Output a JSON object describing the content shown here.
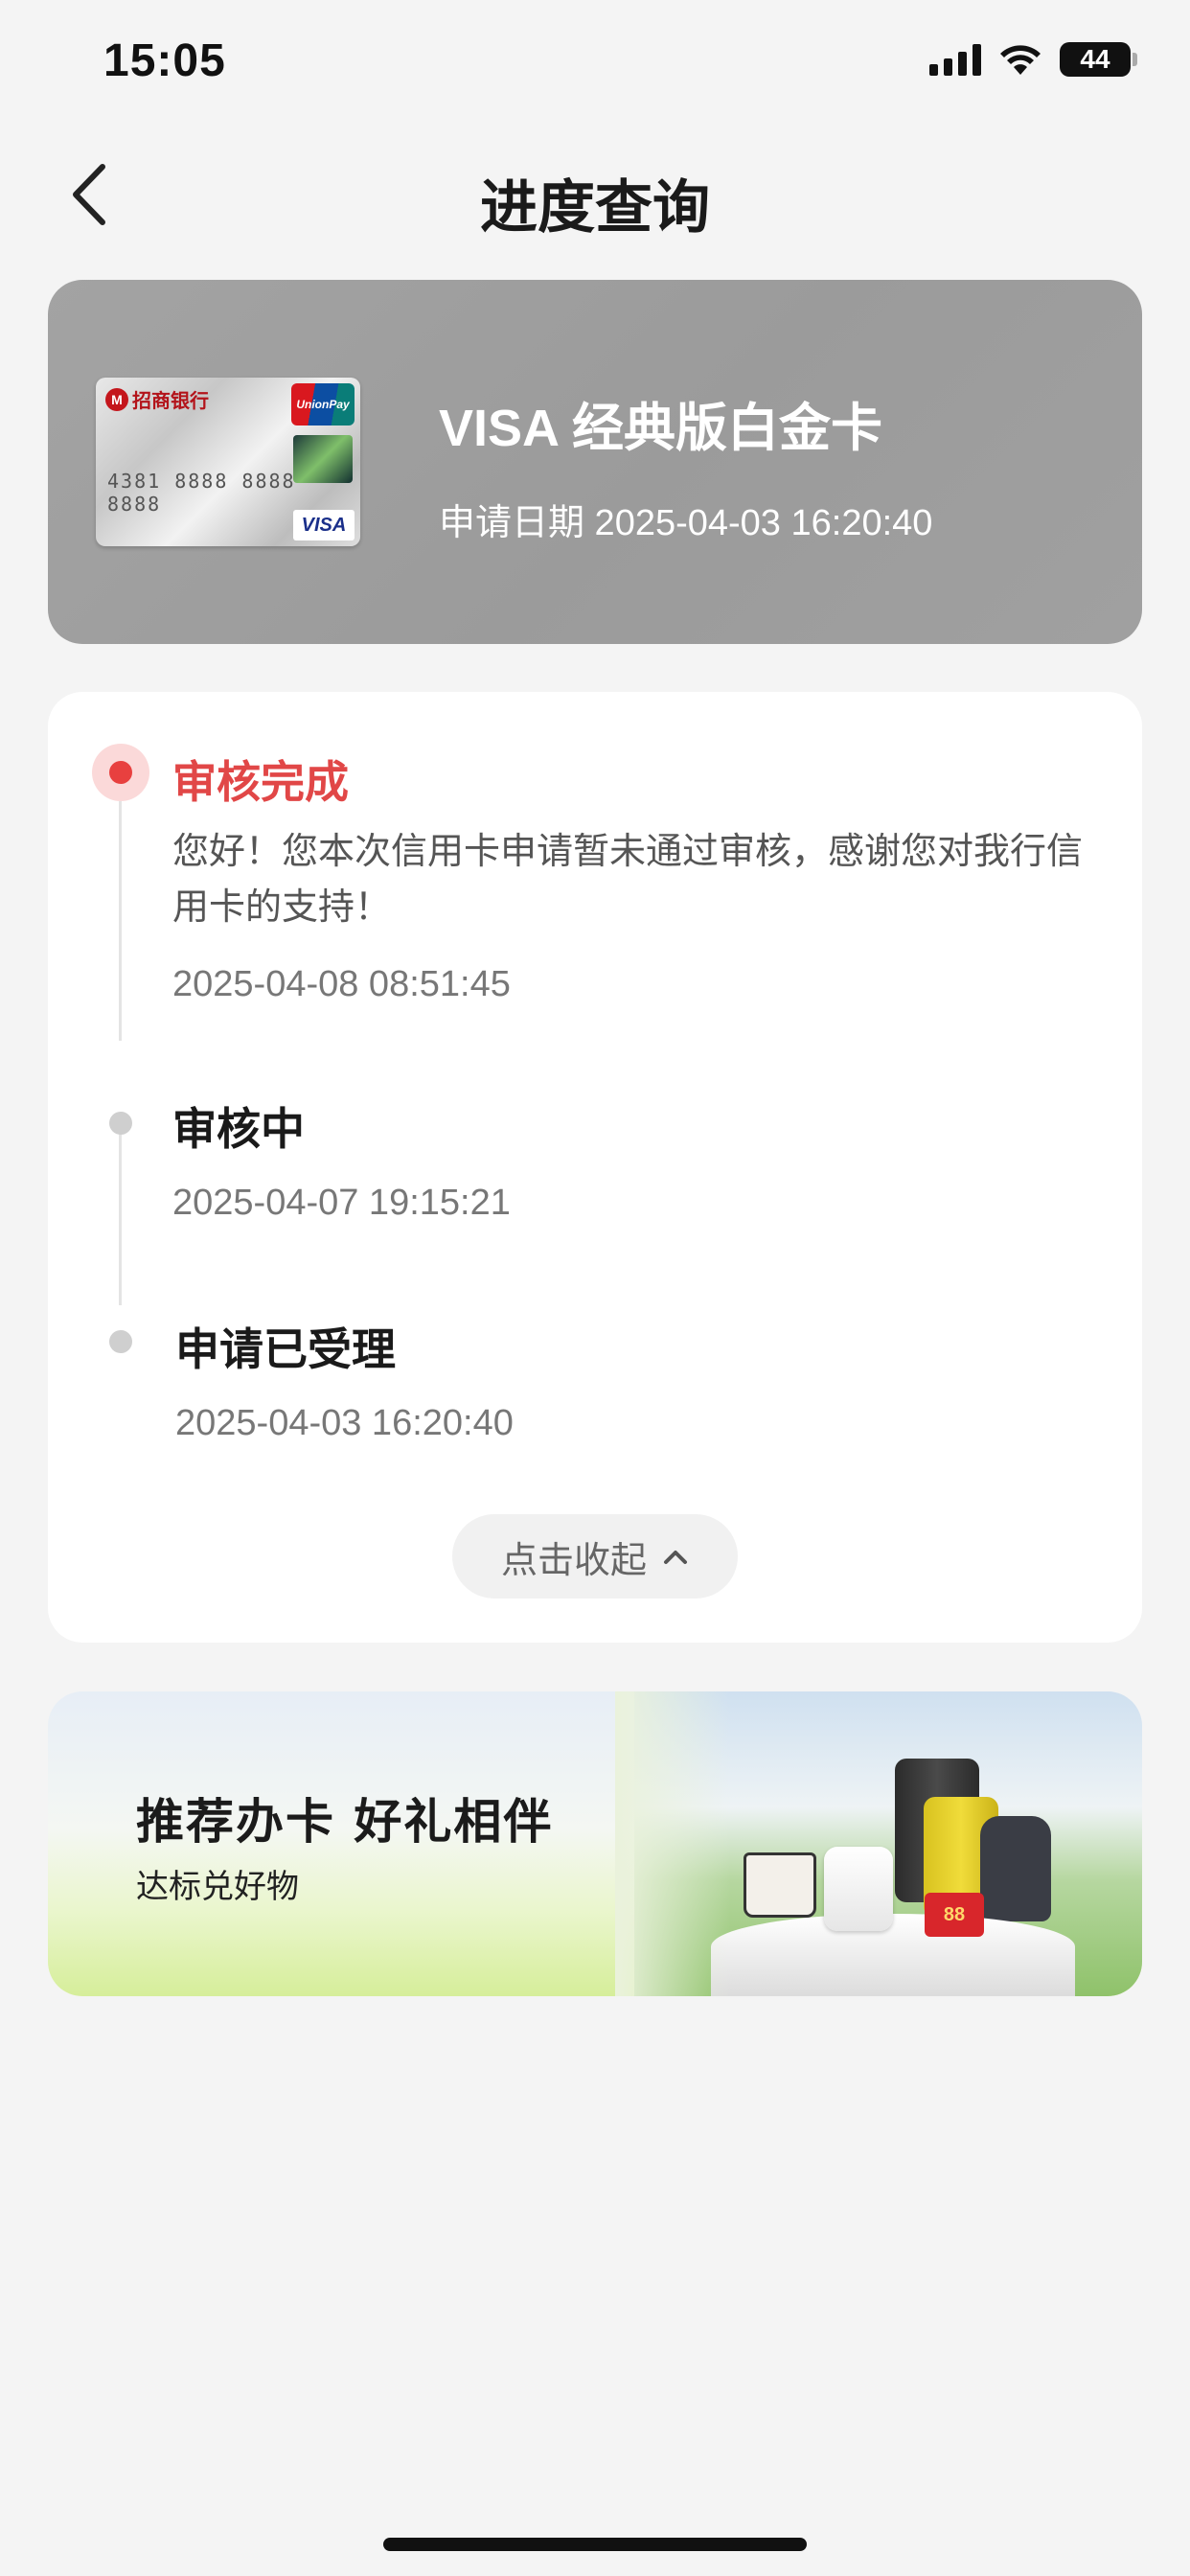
{
  "status_bar": {
    "time": "15:05",
    "battery": "44"
  },
  "header": {
    "title": "进度查询"
  },
  "card": {
    "name": "VISA 经典版白金卡",
    "apply_date": "申请日期 2025-04-03 16:20:40",
    "image": {
      "bank": "招商银行",
      "network": "UnionPay",
      "number_preview": "4381 8888 8888 8888",
      "visa": "VISA"
    }
  },
  "timeline": {
    "steps": [
      {
        "title": "审核完成",
        "description": "您好！您本次信用卡申请暂未通过审核，感谢您对我行信用卡的支持！",
        "time": "2025-04-08 08:51:45",
        "active": true
      },
      {
        "title": "审核中",
        "time": "2025-04-07 19:15:21",
        "active": false
      },
      {
        "title": "申请已受理",
        "time": "2025-04-03 16:20:40",
        "active": false
      }
    ],
    "collapse_label": "点击收起"
  },
  "promo": {
    "title": "推荐办卡 好礼相伴",
    "subtitle": "达标兑好物",
    "badge": "88"
  },
  "colors": {
    "accent_red": "#e14747",
    "background": "#f4f4f4",
    "card_panel": "#9e9e9e"
  },
  "icons": {
    "back": "chevron-left-icon",
    "collapse": "chevron-up-icon",
    "signal": "cellular-signal-icon",
    "wifi": "wifi-icon",
    "battery": "battery-icon"
  }
}
